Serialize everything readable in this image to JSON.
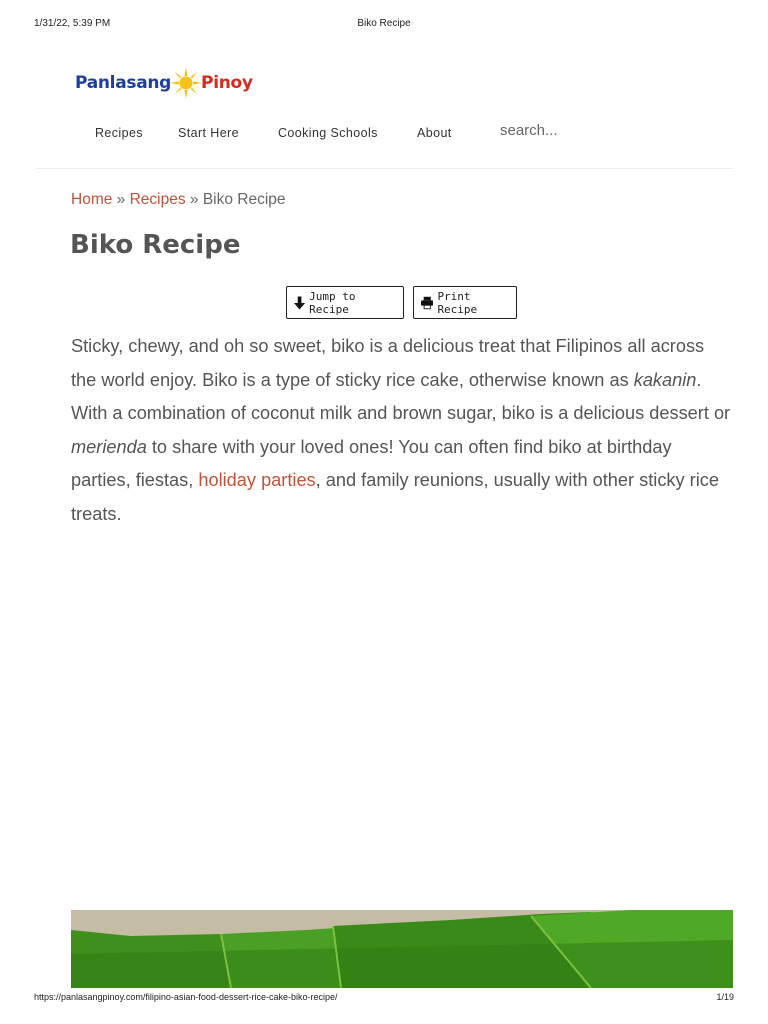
{
  "print_header": {
    "timestamp": "1/31/22, 5:39 PM",
    "title": "Biko Recipe"
  },
  "logo": {
    "word1": "Panlasang",
    "word2": "Pinoy"
  },
  "nav": {
    "items": [
      "Recipes",
      "Start Here",
      "Cooking Schools",
      "About"
    ],
    "search_placeholder": "search..."
  },
  "breadcrumb": {
    "home": "Home",
    "sep1": " » ",
    "recipes": "Recipes",
    "sep2": " » ",
    "current": "Biko Recipe"
  },
  "page_title": "Biko Recipe",
  "buttons": {
    "jump": "Jump to Recipe",
    "print": "Print Recipe"
  },
  "intro": {
    "p1": "Sticky, chewy, and oh so sweet, biko is a delicious treat that Filipinos all across the world enjoy. Biko is a type of sticky rice cake, otherwise known as ",
    "em1": "kakanin",
    "p2": ". With a combination of coconut milk and brown sugar, biko is a delicious dessert or ",
    "em2": "merienda",
    "p3": " to share with your loved ones! You can often find biko at birthday parties, fiestas, ",
    "link": "holiday parties",
    "p4": ", and family reunions, usually with other sticky rice treats."
  },
  "print_footer": {
    "url": "https://panlasangpinoy.com/filipino-asian-food-dessert-rice-cake-biko-recipe/",
    "page": "1/19"
  },
  "colors": {
    "link": "#c0533a",
    "logo_blue": "#1e3f9e",
    "logo_red": "#d62a1f",
    "sun": "#f6c21a",
    "leaf": "#3e9a1c"
  }
}
